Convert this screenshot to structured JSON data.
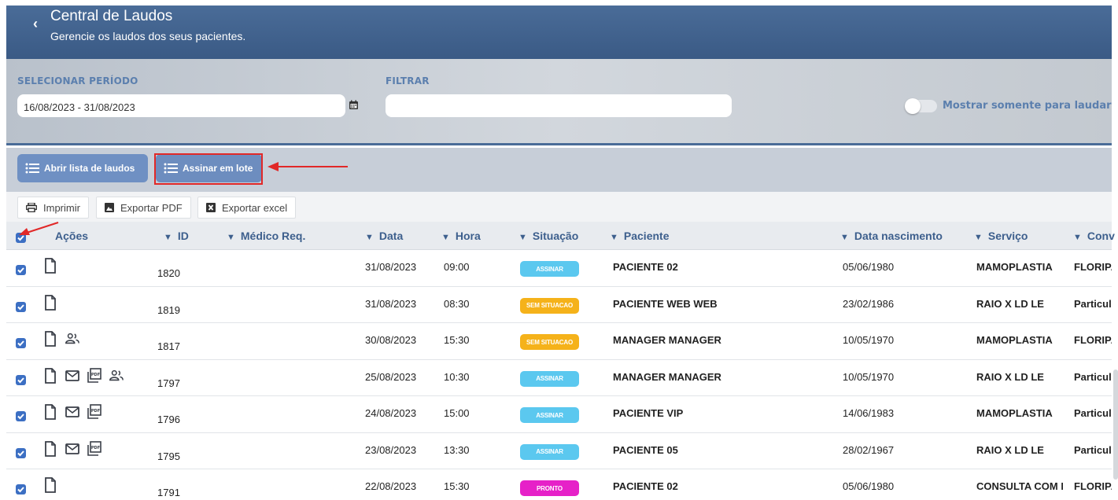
{
  "header": {
    "back_icon": "chevron-left-icon",
    "title": "Central de Laudos",
    "subtitle": "Gerencie os laudos dos seus pacientes."
  },
  "filters": {
    "period_label": "SELECIONAR PERÍODO",
    "period_value": "16/08/2023 - 31/08/2023",
    "filter_label": "FILTRAR",
    "filter_value": "",
    "toggle_label": "Mostrar somente para laudar",
    "toggle_on": false
  },
  "actions": {
    "open_list": "Abrir lista de laudos",
    "batch_sign": "Assinar em lote"
  },
  "toolbar": {
    "print": "Imprimir",
    "export_pdf": "Exportar PDF",
    "export_excel": "Exportar excel"
  },
  "columns": [
    "Ações",
    "ID",
    "Médico Req.",
    "Data",
    "Hora",
    "Situação",
    "Paciente",
    "Data nascimento",
    "Serviço",
    "Conv"
  ],
  "status_colors": {
    "ASSINAR": "#5bc8ef",
    "SEM SITUACAO": "#f5b21a",
    "PRONTO": "#e621c8"
  },
  "rows": [
    {
      "checked": true,
      "icons": [
        "document-icon"
      ],
      "id": "1820",
      "medico": "",
      "data": "31/08/2023",
      "hora": "09:00",
      "situacao": "ASSINAR",
      "paciente": "PACIENTE 02",
      "nascimento": "05/06/1980",
      "servico": "MAMOPLASTIA",
      "convenio": "FLORIPA"
    },
    {
      "checked": true,
      "icons": [
        "document-icon"
      ],
      "id": "1819",
      "medico": "",
      "data": "31/08/2023",
      "hora": "08:30",
      "situacao": "SEM SITUACAO",
      "paciente": "PACIENTE WEB WEB",
      "nascimento": "23/02/1986",
      "servico": "RAIO X LD LE",
      "convenio": "Particul"
    },
    {
      "checked": true,
      "icons": [
        "document-icon",
        "users-icon"
      ],
      "id": "1817",
      "medico": "",
      "data": "30/08/2023",
      "hora": "15:30",
      "situacao": "SEM SITUACAO",
      "paciente": "MANAGER MANAGER",
      "nascimento": "10/05/1970",
      "servico": "MAMOPLASTIA",
      "convenio": "FLORIPA"
    },
    {
      "checked": true,
      "icons": [
        "document-icon",
        "mail-icon",
        "pdf-icon",
        "users-icon"
      ],
      "id": "1797",
      "medico": "",
      "data": "25/08/2023",
      "hora": "10:30",
      "situacao": "ASSINAR",
      "paciente": "MANAGER MANAGER",
      "nascimento": "10/05/1970",
      "servico": "RAIO X LD LE",
      "convenio": "Particul"
    },
    {
      "checked": true,
      "icons": [
        "document-icon",
        "mail-icon",
        "pdf-icon"
      ],
      "id": "1796",
      "medico": "",
      "data": "24/08/2023",
      "hora": "15:00",
      "situacao": "ASSINAR",
      "paciente": "PACIENTE VIP",
      "nascimento": "14/06/1983",
      "servico": "MAMOPLASTIA",
      "convenio": "Particul"
    },
    {
      "checked": true,
      "icons": [
        "document-icon",
        "mail-icon",
        "pdf-icon"
      ],
      "id": "1795",
      "medico": "",
      "data": "23/08/2023",
      "hora": "13:30",
      "situacao": "ASSINAR",
      "paciente": "PACIENTE 05",
      "nascimento": "28/02/1967",
      "servico": "RAIO X LD LE",
      "convenio": "Particul"
    },
    {
      "checked": true,
      "icons": [
        "document-icon"
      ],
      "id": "1791",
      "medico": "",
      "data": "22/08/2023",
      "hora": "15:30",
      "situacao": "PRONTO",
      "paciente": "PACIENTE 02",
      "nascimento": "05/06/1980",
      "servico": "CONSULTA COM L",
      "convenio": "FLORIPA"
    }
  ]
}
